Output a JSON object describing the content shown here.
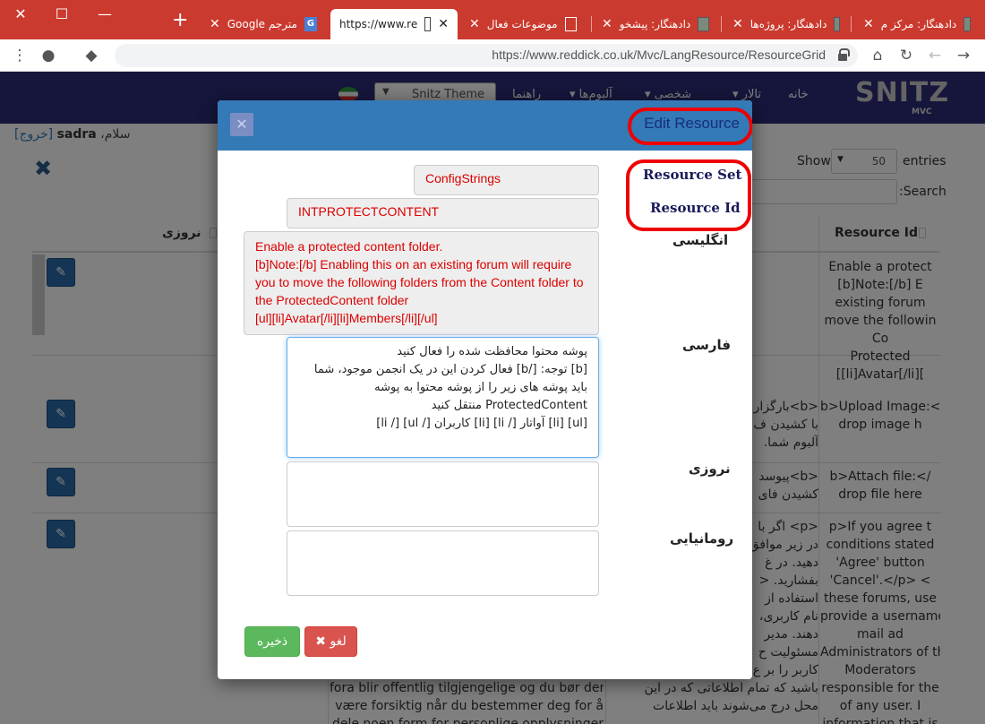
{
  "browser": {
    "tabs": [
      {
        "label": "دادهنگار: مرکز م"
      },
      {
        "label": "دادهنگار: پروژه‌ها"
      },
      {
        "label": "دادهنگار: پیشخو"
      },
      {
        "label": "موضوعات فعال"
      },
      {
        "label": "https://www.re"
      },
      {
        "label": "مترجم Google"
      }
    ],
    "url": "https://www.reddick.co.uk/Mvc/LangResource/ResourceGrid"
  },
  "nav": {
    "items": [
      "خانه",
      "تالار",
      "شخصی",
      "آلبوم‌ها",
      "راهنما"
    ],
    "theme_label": "Snitz Theme",
    "logo": "SNITZ",
    "logo_sub": "MVC"
  },
  "page": {
    "greeting_prefix": "سلام،",
    "username": "sadra",
    "logout": "[خروج]",
    "show_label": "Show",
    "show_value": "50",
    "entries_label": "entries",
    "search_label": "Search:",
    "col_resource_id": "Resource Id",
    "col_nowruzi": "نروزی",
    "rows": [
      {
        "lines": [
          "Enable a protect",
          "[b]Note:[/b] E",
          "existing forum",
          "move the followin",
          "Co",
          "Protected",
          "[[li]Avatar[/li]["
        ]
      },
      {
        "lines": [
          "b>Upload Image:</",
          "drop image h"
        ],
        "mid": [
          "<b>بارگزار",
          "با کشیدن ف",
          "آلبوم شما."
        ]
      },
      {
        "lines": [
          "b>Attach file:</",
          "drop file here"
        ],
        "mid": [
          "<b>پیوسد",
          "کشیدن فای"
        ]
      },
      {
        "lines": [
          "p>If you agree t",
          "conditions stated",
          "'Agree' button",
          "'Cancel'.</p> <",
          "these forums, use",
          "provide a username",
          "mail ad",
          "Administrators of the",
          "Moderators",
          "responsible for the",
          "of any user. I",
          "information that is"
        ],
        "mid": [
          "<p> اگر با",
          "در زیر موافق",
          "دهید. در غ",
          "بفشارید. <",
          "استفاده از",
          "نام کاربری،",
          "دهند. مدیر",
          "مسئولیت ح",
          "کاربر را بر ع",
          "باشید که تمام اطلاعاتی که در این",
          "محل درج می‌شوند باید اطلاعات"
        ],
        "left": [
          "fora blir offentlig tilgjengelige og du bør derfor",
          "være forsiktig når du bestemmer deg for å",
          "dele noen form for personlige opplysninger"
        ]
      }
    ]
  },
  "modal": {
    "title": "Edit Resource",
    "close_icon": "close-icon",
    "labels": {
      "resource_set": "Resource Set",
      "resource_id": "Resource Id",
      "english": "انگلیسی",
      "farsi": "فارسی",
      "nowruzi": "نروزی",
      "romanian": "رومانیایی"
    },
    "resource_set_value": "ConfigStrings",
    "resource_id_value": "INTPROTECTCONTENT",
    "english_value": "Enable a protected content folder.\n[b]Note:[/b] Enabling this on an existing forum will require you to move the following folders from the Content folder to the ProtectedContent folder\n[ul][li]Avatar[/li][li]Members[/li][/ul]",
    "farsi_value": "پوشه محتوا محافظت شده را فعال کنید\n[b] توجه: [/b] فعال کردن این در یک انجمن موجود، شما باید پوشه های زیر را از پوشه محتوا به پوشه ProtectedContent منتقل کنید\n[ul] [li] آواتار [/ li] [li] کاربران [/ ul] [/ li]",
    "nowruzi_value": "",
    "romanian_value": "",
    "save_label": "ذخیره",
    "cancel_label": "لغو",
    "cancel_icon": "x-icon"
  },
  "colors": {
    "tabstrip": "#cb3a2e",
    "nav": "#2c2c7a",
    "modal_header": "#337ab7",
    "annotation": "#ee0000",
    "save": "#5cb85c",
    "cancel": "#d9534f"
  }
}
